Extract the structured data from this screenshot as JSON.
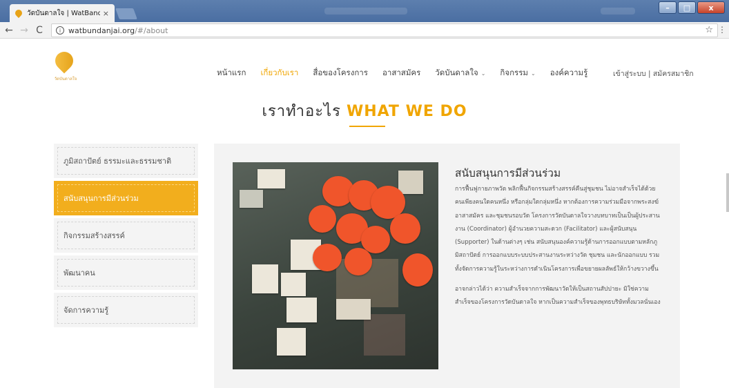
{
  "browser": {
    "tab_title": "วัดบันดาลใจ | WatBandanj",
    "tab_close": "×",
    "url_host": "watbundanjai.org",
    "url_path": "/#/about",
    "info_glyph": "i",
    "back_icon": "back-arrow-icon",
    "forward_icon": "forward-arrow-icon",
    "reload_icon": "reload-icon",
    "star_icon": "star-icon",
    "menu_icon": "kebab-menu-icon",
    "window_buttons": [
      "–",
      "□",
      "x"
    ]
  },
  "header": {
    "logo_caption": "วัดบันดาลใจ",
    "nav": [
      {
        "label": "หน้าแรก",
        "active": false,
        "dropdown": false
      },
      {
        "label": "เกี่ยวกับเรา",
        "active": true,
        "dropdown": false
      },
      {
        "label": "สื่อของโครงการ",
        "active": false,
        "dropdown": false
      },
      {
        "label": "อาสาสมัคร",
        "active": false,
        "dropdown": false
      },
      {
        "label": "วัดบันดาลใจ",
        "active": false,
        "dropdown": true
      },
      {
        "label": "กิจกรรม",
        "active": false,
        "dropdown": true
      },
      {
        "label": "องค์ความรู้",
        "active": false,
        "dropdown": false
      }
    ],
    "auth": "เข้าสู่ระบบ | สมัครสมาชิก",
    "caret": "⌄"
  },
  "section": {
    "title_thai": "เราทำอะไร",
    "title_en": "WHAT WE DO"
  },
  "sidebar": {
    "items": [
      {
        "label": "ภูมิสถาปัตย์ ธรรมะและธรรมชาติ",
        "active": false
      },
      {
        "label": "สนับสนุนการมีส่วนร่วม",
        "active": true
      },
      {
        "label": "กิจกรรมสร้างสรรค์",
        "active": false
      },
      {
        "label": "พัฒนาคน",
        "active": false
      },
      {
        "label": "จัดการความรู้",
        "active": false
      }
    ]
  },
  "content": {
    "title": "สนับสนุนการมีส่วนร่วม",
    "paragraphs": [
      "การฟื้นฟูกายภาพวัด พลิกฟื้นกิจกรรมสร้างสรรค์คืนสู่ชุมชน ไม่อาจสำเร็จได้ด้วยคนเพียงคนใดคนหนึ่ง หรือกลุ่มใดกลุ่มหนึ่ง หากต้องการความร่วมมือจากพระสงฆ์ อาสาสมัคร และชุมชนรอบวัด โครงการวัดบันดาลใจวางบทบาทเป็นเป็นผู้ประสานงาน (Coordinator) ผู้อำนวยความสะดวก (Facilitator) และผู้สนับสนุน (Supporter) ในด้านต่างๆ เช่น สนับสนุนองค์ความรู้ด้านการออกแบบตามหลักภูมิสถาปัตย์ การออกแบบระบบประสานงานระหว่างวัด ชุมชน และนักออกแบบ รวมทั้งจัดการความรู้ในระหว่างการดำเนินโครงการเพื่อขยายผลลัพธ์ให้กว้างขวางขึ้น",
      "อาจกล่าวได้ว่า ความสำเร็จจากการพัฒนาวัดให้เป็นสถานสัปปายะ มิใช่ความสำเร็จของโครงการวัดบันดาลใจ หากเป็นความสำเร็จของพุทธบริษัททั้งมวลนั่นเอง"
    ],
    "photo_alt": "กระดาษโน้ตและวงกลมสีส้มบนผนังเวิร์กชอป",
    "photo_accent": "#f0552b"
  },
  "colors": {
    "accent": "#f0a500",
    "sidebar_active": "#f2ae1d",
    "chrome": "#4a6ea2"
  }
}
